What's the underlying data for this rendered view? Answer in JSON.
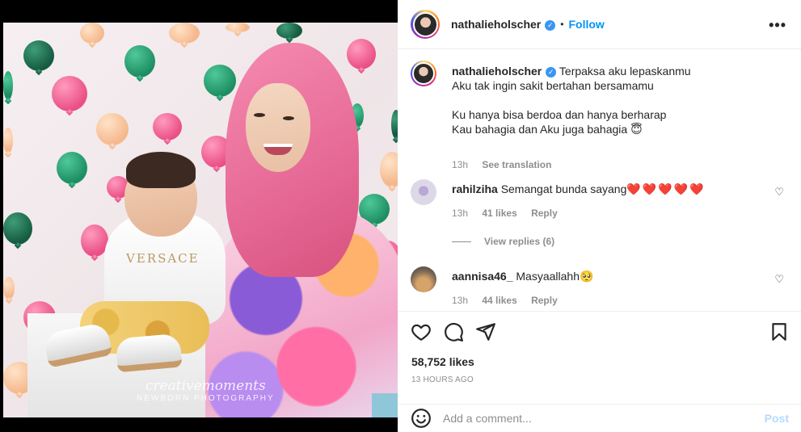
{
  "post": {
    "author": "nathalieholscher",
    "follow_label": "Follow",
    "dot": "•",
    "more_icon": "more-horizontal-icon"
  },
  "media": {
    "watermark_script": "creativemoments",
    "watermark_sub": "NEWBORN PHOTOGRAPHY",
    "shirt_text": "VERSACE"
  },
  "caption": {
    "user": "nathalieholscher",
    "line1": "Terpaksa aku lepaskanmu",
    "line2": "Aku tak ingin sakit bertahan bersamamu",
    "line3": "Ku hanya bisa berdoa dan hanya berharap",
    "line4": "Kau bahagia dan Aku juga bahagia 😇",
    "time": "13h",
    "see_translation": "See translation"
  },
  "comments": [
    {
      "user": "rahilziha",
      "text": "Semangat bunda sayang",
      "hearts": "❤️❤️❤️❤️❤️",
      "time": "13h",
      "likes": "41 likes",
      "reply": "Reply",
      "view_replies": "View replies (6)"
    },
    {
      "user": "aannisa46_",
      "text": "Masyaallahh🥺",
      "time": "13h",
      "likes": "44 likes",
      "reply": "Reply"
    }
  ],
  "stats": {
    "likes": "58,752 likes",
    "time_ago": "13 HOURS AGO"
  },
  "composer": {
    "placeholder": "Add a comment...",
    "post_label": "Post"
  },
  "colors": {
    "accent": "#0095f6",
    "post_disabled": "#b3dbff",
    "heart_red": "#ed4956"
  }
}
